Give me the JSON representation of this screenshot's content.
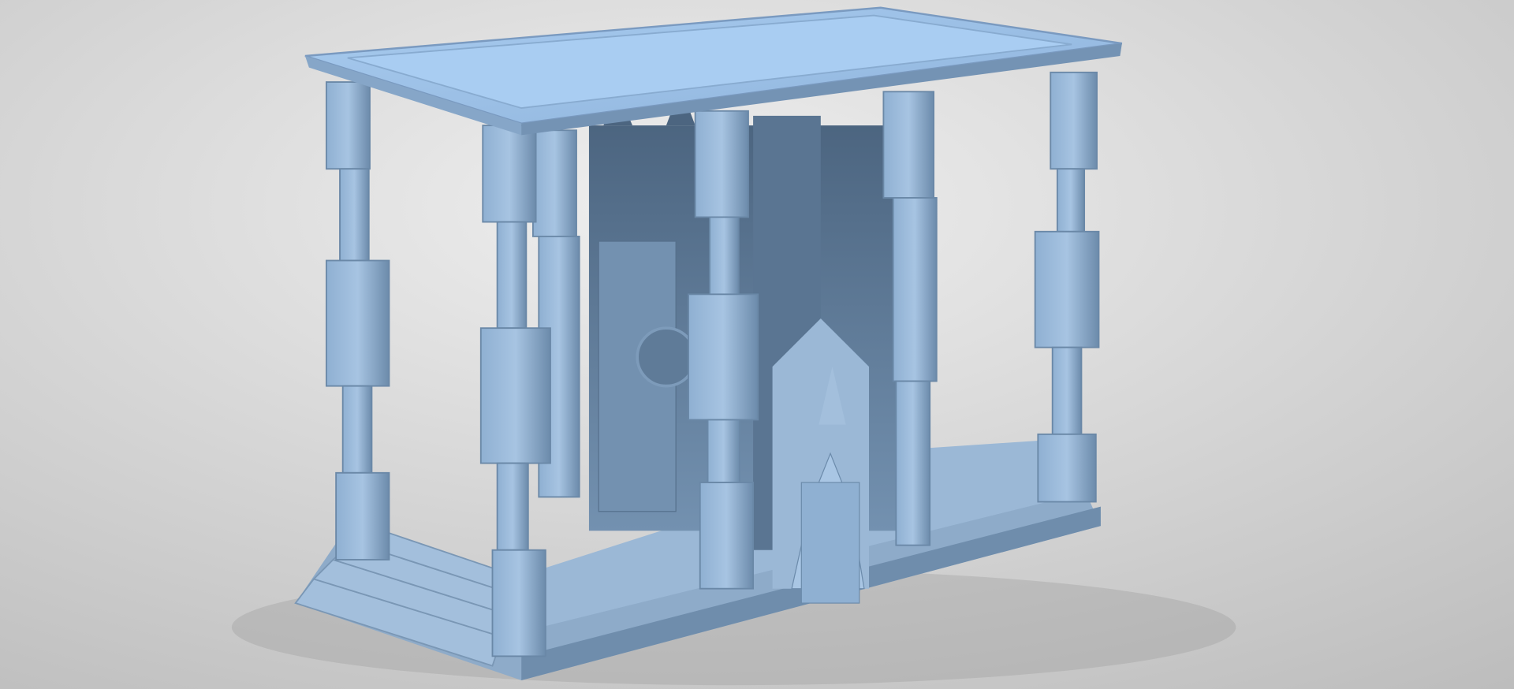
{
  "scene": {
    "subject": "diorama-model",
    "colors": {
      "background_light": "#ececec",
      "background_dark": "#bdbdbd",
      "model_light": "#a9c6e4",
      "model_mid": "#7f9fbf",
      "model_dark": "#4f6a86",
      "model_top": "#9ec2e8"
    }
  }
}
